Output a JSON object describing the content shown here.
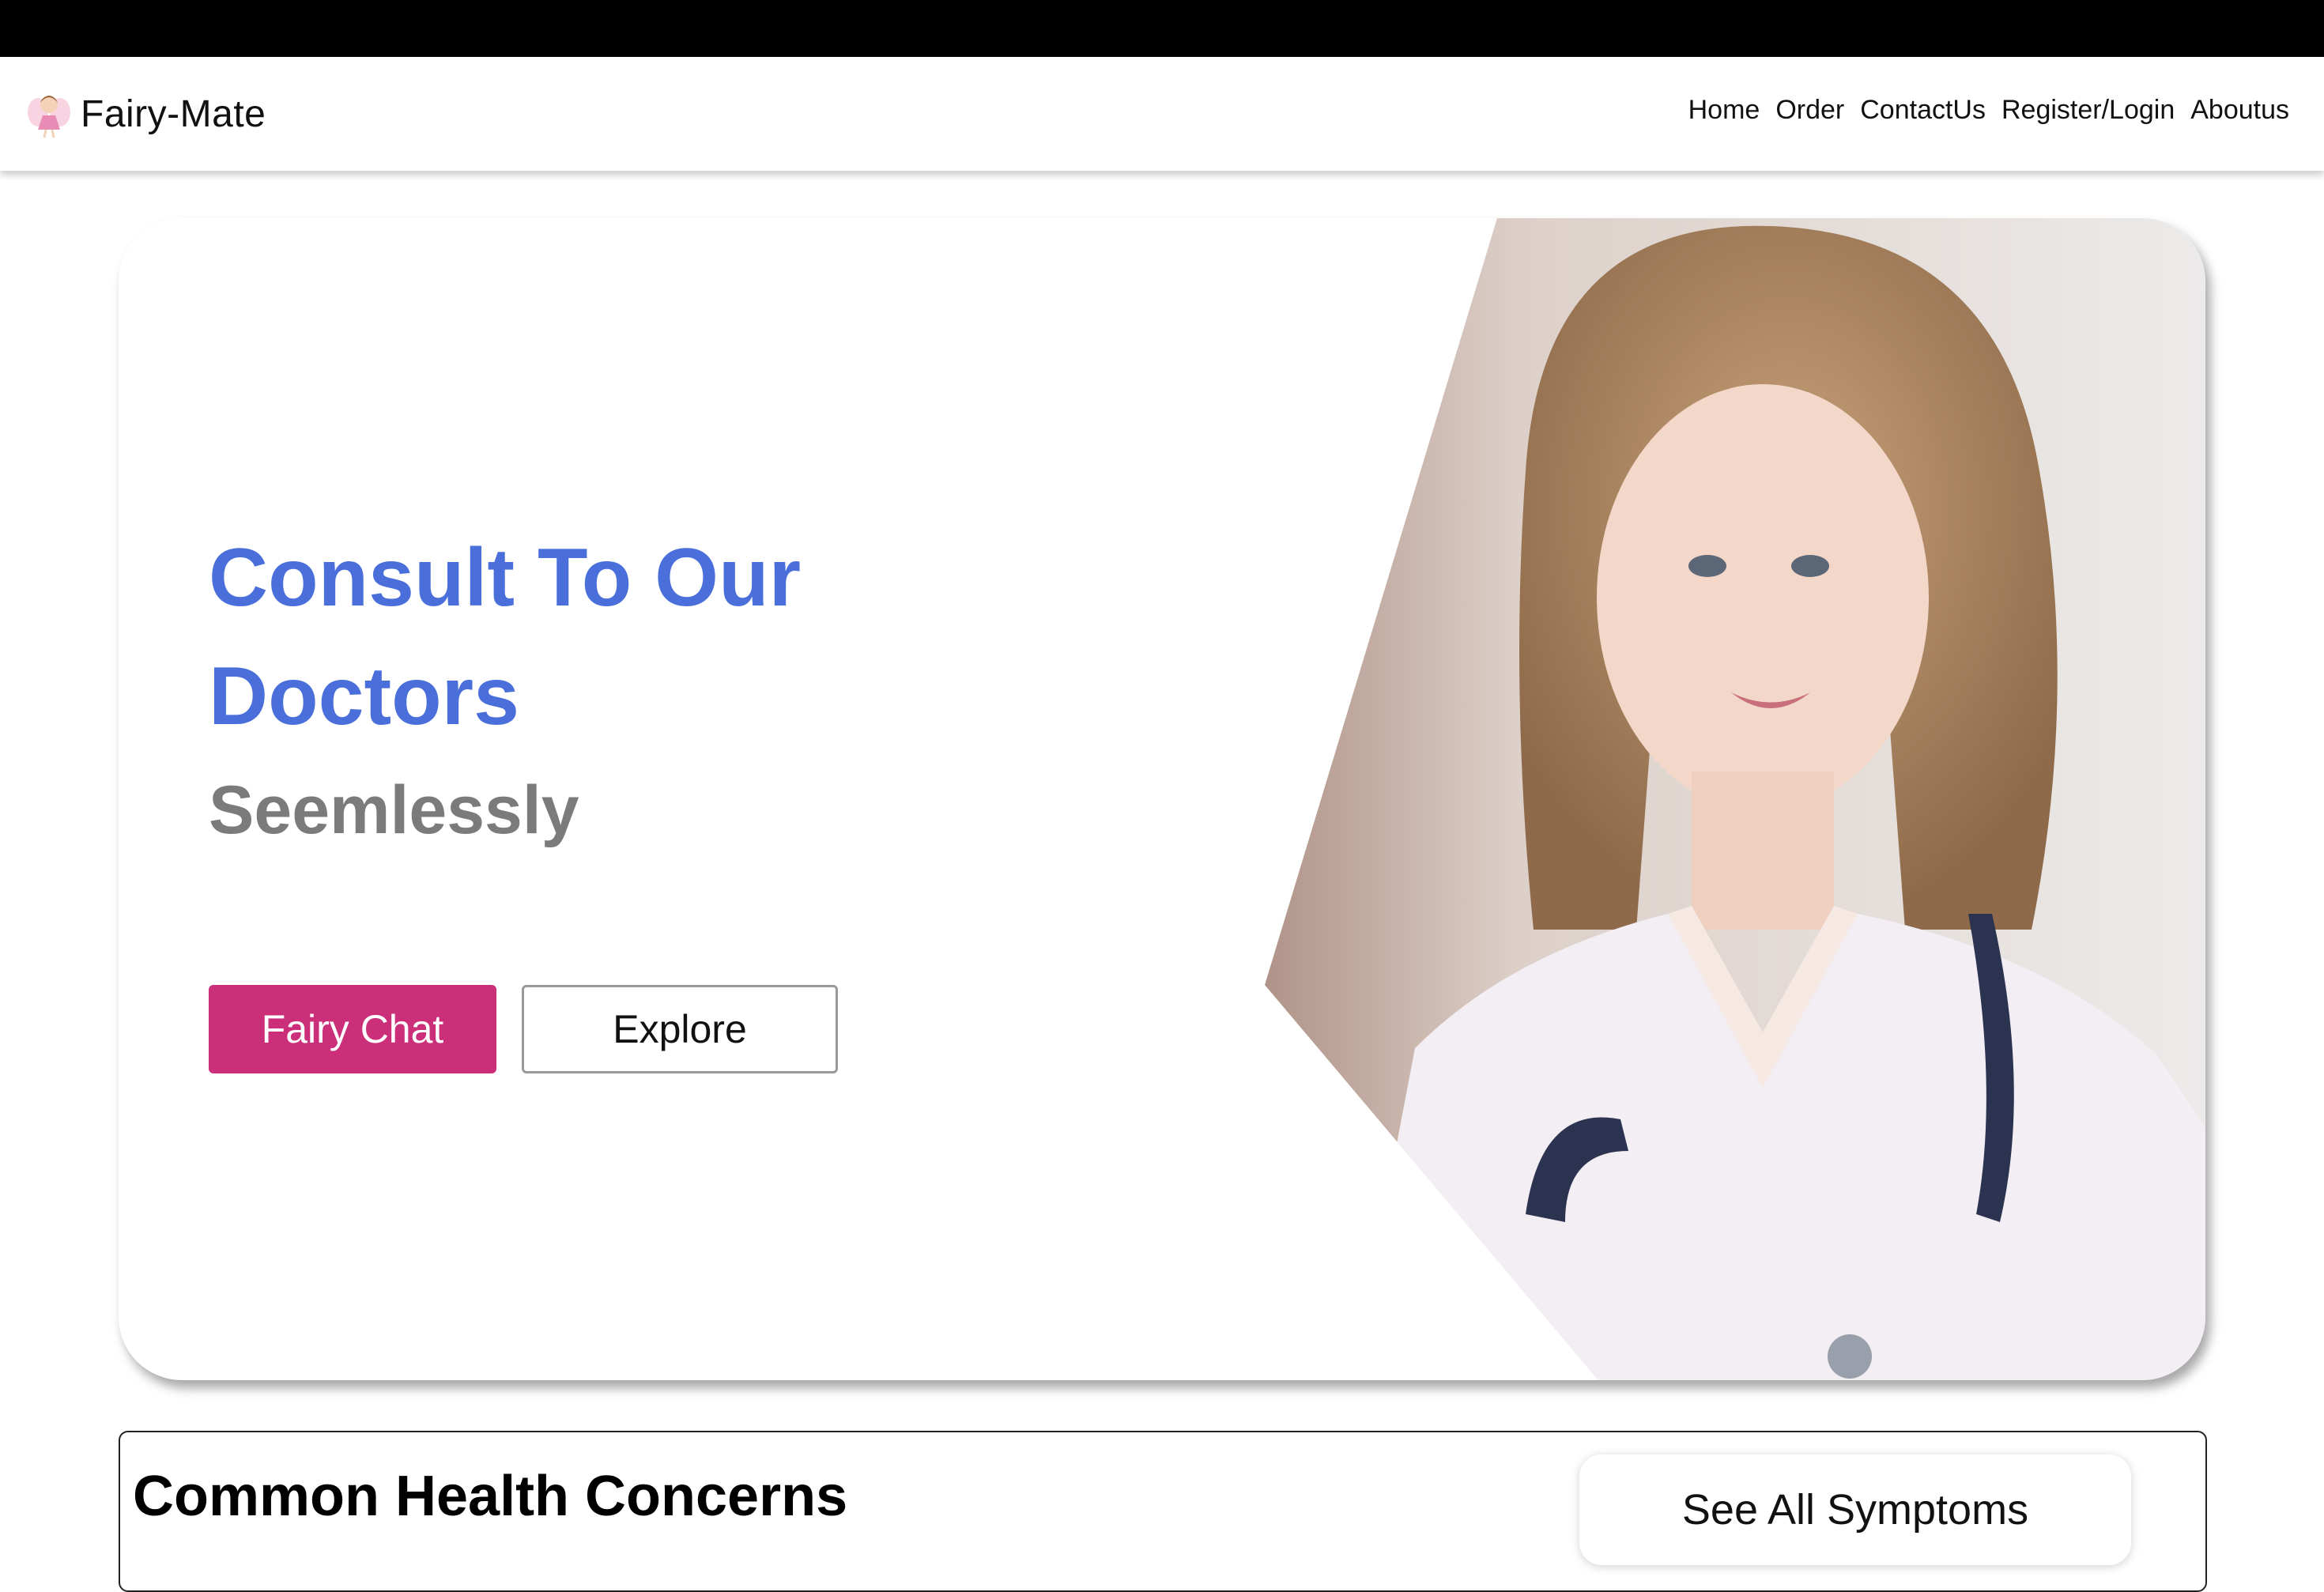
{
  "brand": {
    "name": "Fairy-Mate",
    "logo_icon": "fairy-icon"
  },
  "nav": {
    "links": [
      "Home",
      "Order",
      "ContactUs",
      "Register/Login",
      "Aboutus"
    ]
  },
  "hero": {
    "title": "Consult To Our Doctors",
    "subtitle": "Seemlessly",
    "primary_button": "Fairy Chat",
    "secondary_button": "Explore",
    "image": "doctor-photo",
    "colors": {
      "title": "#4a6fdb",
      "subtitle": "#7b7b7b",
      "primary": "#cc2f7a"
    }
  },
  "concerns": {
    "title": "Common Health Concerns",
    "see_all_button": "See All Symptoms"
  }
}
